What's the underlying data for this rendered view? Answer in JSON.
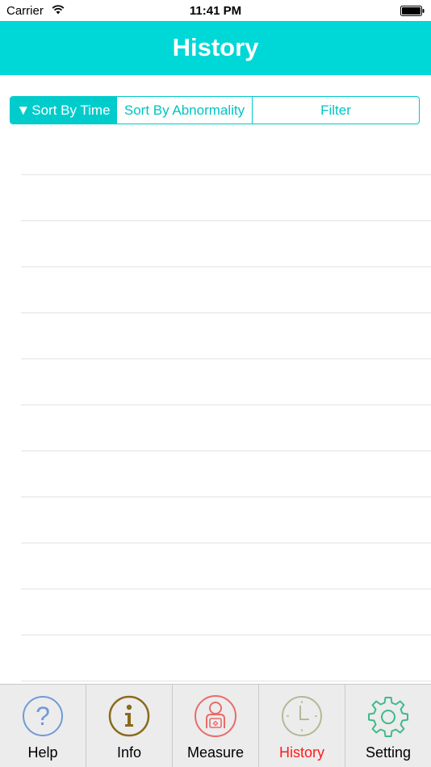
{
  "status_bar": {
    "carrier": "Carrier",
    "time": "11:41 PM"
  },
  "nav": {
    "title": "History"
  },
  "segmented": {
    "indicator": "▼",
    "items": [
      "Sort By Time",
      "Sort By Abnormality",
      "Filter"
    ],
    "selected": "Sort By Time"
  },
  "tabs": [
    {
      "label": "Help",
      "icon": "question-icon",
      "color": "#6f9bd6"
    },
    {
      "label": "Info",
      "icon": "info-icon",
      "color": "#8a6a1a"
    },
    {
      "label": "Measure",
      "icon": "measure-person-icon",
      "color": "#ea6b6b"
    },
    {
      "label": "History",
      "icon": "clock-icon",
      "color": "#b7b796"
    },
    {
      "label": "Setting",
      "icon": "gear-icon",
      "color": "#3fb98b"
    }
  ],
  "active_tab": "History",
  "colors": {
    "accent": "#00d7d7",
    "active_tab": "#ff1a1a"
  }
}
